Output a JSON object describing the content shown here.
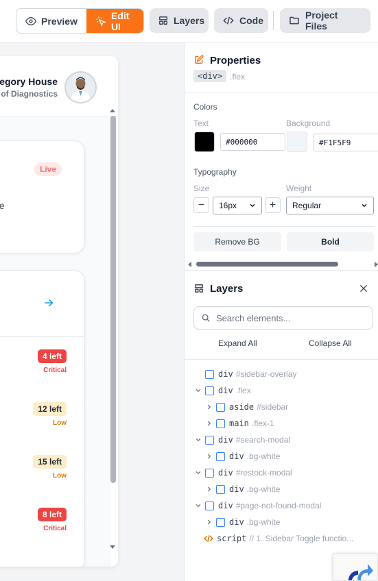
{
  "toolbar": {
    "preview_label": "Preview",
    "edit_ui_label": "Edit UI",
    "layers_label": "Layers",
    "code_label": "Code",
    "project_files_label": "Project Files"
  },
  "preview": {
    "user_name": "egory House",
    "user_role": "of Diagnostics",
    "live_badge": "Live",
    "card_text": "ue",
    "stock_items": [
      {
        "count": "4 left",
        "level": "Critical",
        "type": "critical"
      },
      {
        "count": "12 left",
        "level": "Low",
        "type": "low"
      },
      {
        "count": "15 left",
        "level": "Low",
        "type": "low"
      },
      {
        "count": "8 left",
        "level": "Critical",
        "type": "critical"
      }
    ]
  },
  "properties": {
    "title": "Properties",
    "tag": "<div>",
    "class_name": ".flex",
    "colors_label": "Colors",
    "text_label": "Text",
    "text_value": "#000000",
    "text_color": "#000000",
    "background_label": "Background",
    "background_value": "#F1F5F9",
    "background_color": "#F1F5F9",
    "typography_label": "Typography",
    "size_label": "Size",
    "size_value": "16px",
    "weight_label": "Weight",
    "weight_value": "Regular",
    "remove_bg_label": "Remove BG",
    "bold_label": "Bold"
  },
  "layers": {
    "title": "Layers",
    "search_placeholder": "Search elements...",
    "expand_all": "Expand All",
    "collapse_all": "Collapse All",
    "nodes": [
      {
        "tag": "div",
        "selector": "#sidebar-overlay",
        "chevron": "",
        "kind": "checkbox"
      },
      {
        "tag": "div",
        "selector": ".flex",
        "chevron": "down",
        "kind": "checkbox"
      },
      {
        "tag": "aside",
        "selector": "#sidebar",
        "chevron": "right",
        "kind": "checkbox"
      },
      {
        "tag": "main",
        "selector": ".flex-1",
        "chevron": "right",
        "kind": "checkbox"
      },
      {
        "tag": "div",
        "selector": "#search-modal",
        "chevron": "down",
        "kind": "checkbox"
      },
      {
        "tag": "div",
        "selector": ".bg-white",
        "chevron": "right",
        "kind": "checkbox"
      },
      {
        "tag": "div",
        "selector": "#restock-modal",
        "chevron": "down",
        "kind": "checkbox"
      },
      {
        "tag": "div",
        "selector": ".bg-white",
        "chevron": "right",
        "kind": "checkbox"
      },
      {
        "tag": "div",
        "selector": "#page-not-found-modal",
        "chevron": "down",
        "kind": "checkbox"
      },
      {
        "tag": "div",
        "selector": ".bg-white",
        "chevron": "right",
        "kind": "checkbox"
      },
      {
        "tag": "script",
        "selector": "// 1. Sidebar Toggle functio...",
        "chevron": "",
        "kind": "code"
      }
    ]
  },
  "colors": {
    "accent": "#f97316",
    "critical": "#ef4444",
    "low_bg": "#fdecc8",
    "link": "#0ea5e9"
  }
}
